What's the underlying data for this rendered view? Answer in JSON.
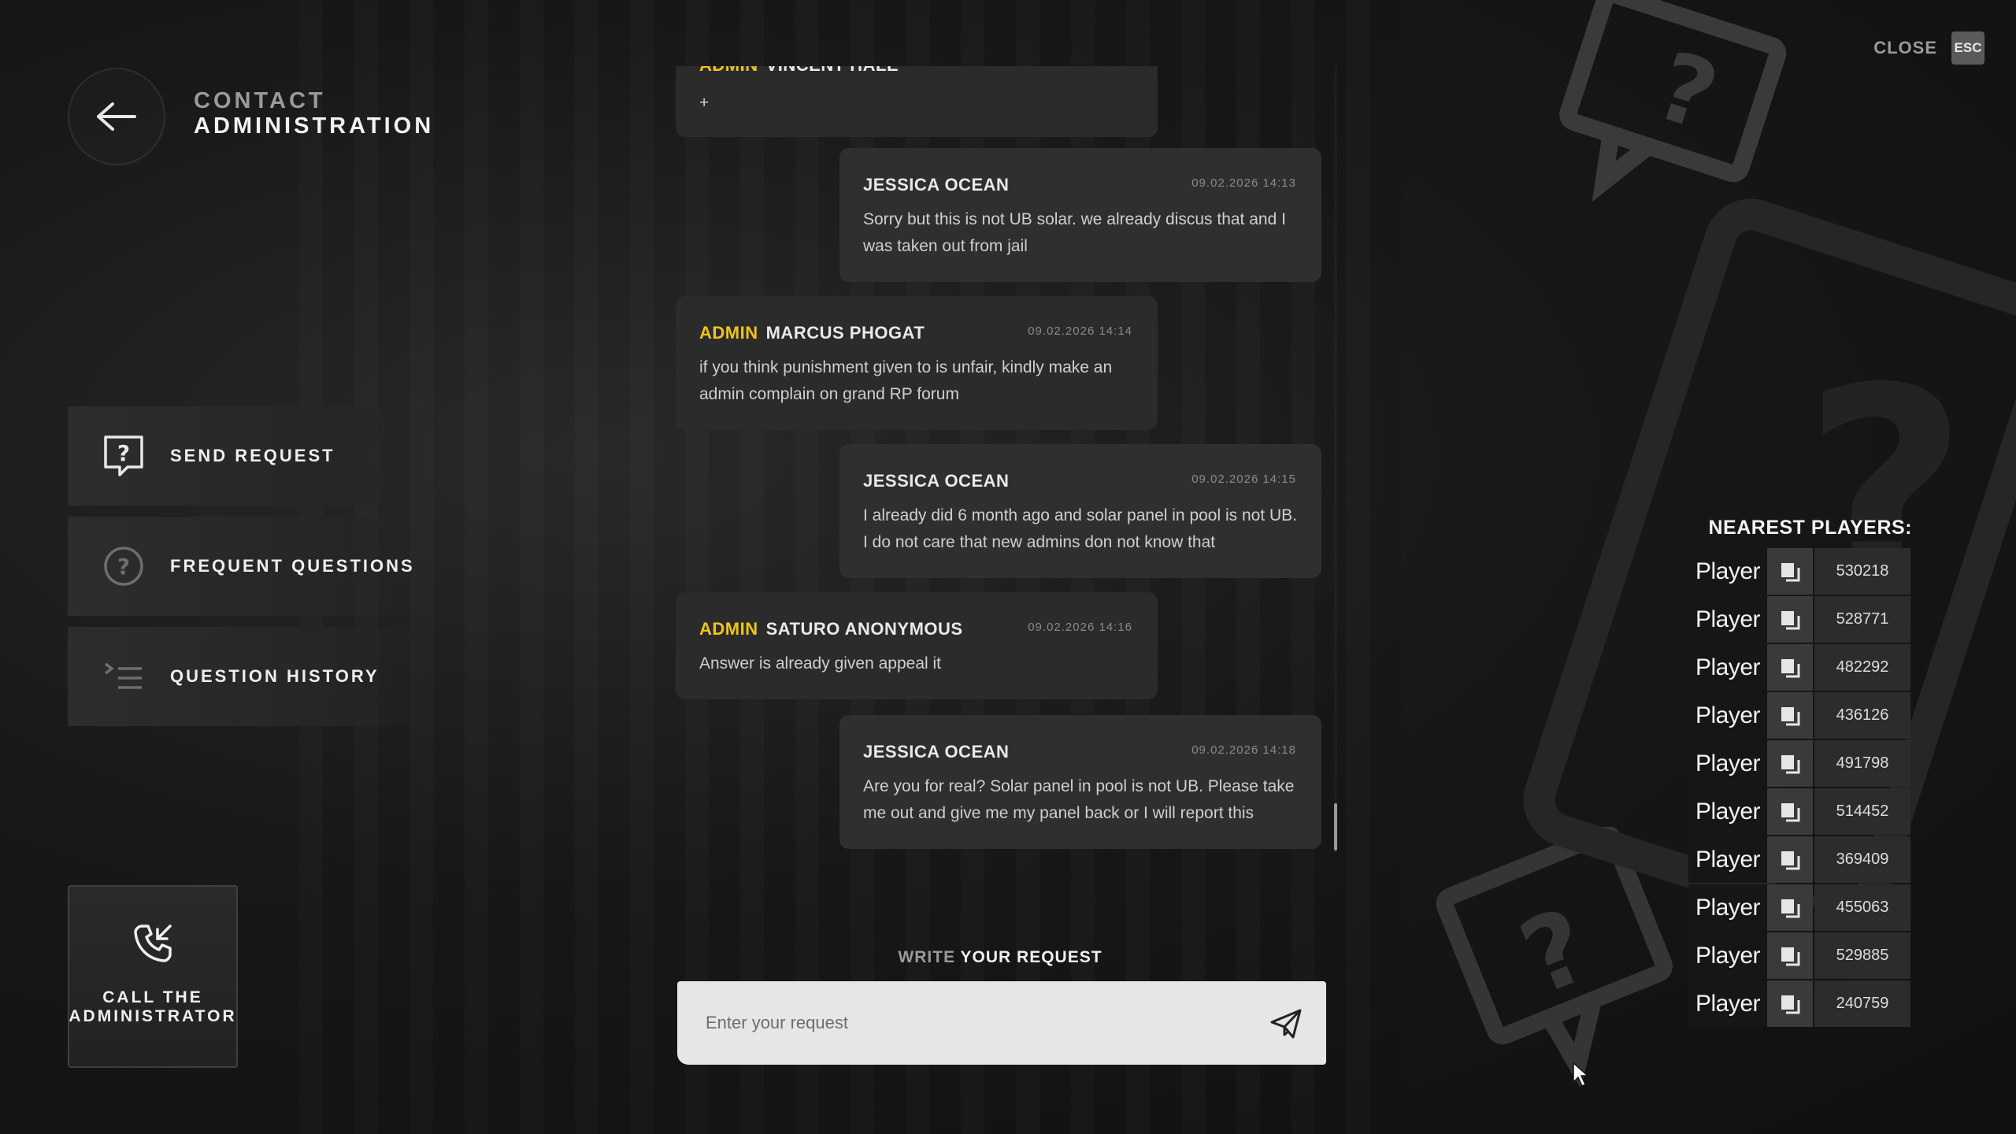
{
  "header": {
    "title_line1": "CONTACT",
    "title_line2": "ADMINISTRATION",
    "close_label": "CLOSE",
    "close_key": "ESC"
  },
  "menu": {
    "items": [
      {
        "label": "SEND REQUEST",
        "icon": "question-box-icon",
        "active": true
      },
      {
        "label": "FREQUENT QUESTIONS",
        "icon": "question-circle-icon",
        "active": false
      },
      {
        "label": "QUESTION HISTORY",
        "icon": "list-icon",
        "active": false
      }
    ],
    "call_button_label_1": "CALL THE",
    "call_button_label_2": "ADMINISTRATOR"
  },
  "chat": {
    "messages": [
      {
        "side": "left",
        "role": "ADMIN",
        "name": "VINCENT HALE",
        "time": "",
        "text": "+"
      },
      {
        "side": "right",
        "role": "",
        "name": "JESSICA OCEAN",
        "time": "09.02.2026 14:13",
        "text": "Sorry but this is not UB solar. we already discus that and I was taken out from jail"
      },
      {
        "side": "left",
        "role": "ADMIN",
        "name": "MARCUS PHOGAT",
        "time": "09.02.2026 14:14",
        "text": "if you think punishment given to is unfair, kindly make an admin complain on grand RP forum"
      },
      {
        "side": "right",
        "role": "",
        "name": "JESSICA OCEAN",
        "time": "09.02.2026 14:15",
        "text": "I already did 6 month ago and solar panel in pool is not UB. I do not care that new admins don not know that"
      },
      {
        "side": "left",
        "role": "ADMIN",
        "name": "SATURO ANONYMOUS",
        "time": "09.02.2026 14:16",
        "text": "Answer is already given appeal it"
      },
      {
        "side": "right",
        "role": "",
        "name": "JESSICA OCEAN",
        "time": "09.02.2026 14:18",
        "text": "Are you for real? Solar panel in pool is not UB. Please take me out and give me my panel back or I will report this"
      }
    ]
  },
  "composer": {
    "label_dim": "WRITE",
    "label_bright": "YOUR REQUEST",
    "placeholder": "Enter your request",
    "value": ""
  },
  "nearest_players": {
    "title": "NEAREST PLAYERS:",
    "players": [
      {
        "name": "Player",
        "id": "530218"
      },
      {
        "name": "Player",
        "id": "528771"
      },
      {
        "name": "Player",
        "id": "482292"
      },
      {
        "name": "Player",
        "id": "436126"
      },
      {
        "name": "Player",
        "id": "491798"
      },
      {
        "name": "Player",
        "id": "514452"
      },
      {
        "name": "Player",
        "id": "369409"
      },
      {
        "name": "Player",
        "id": "455063"
      },
      {
        "name": "Player",
        "id": "529885"
      },
      {
        "name": "Player",
        "id": "240759"
      }
    ]
  },
  "colors": {
    "accent_admin": "#f0c419",
    "bubble": "#2b2b2b",
    "input_bg": "#e6e6e6"
  }
}
